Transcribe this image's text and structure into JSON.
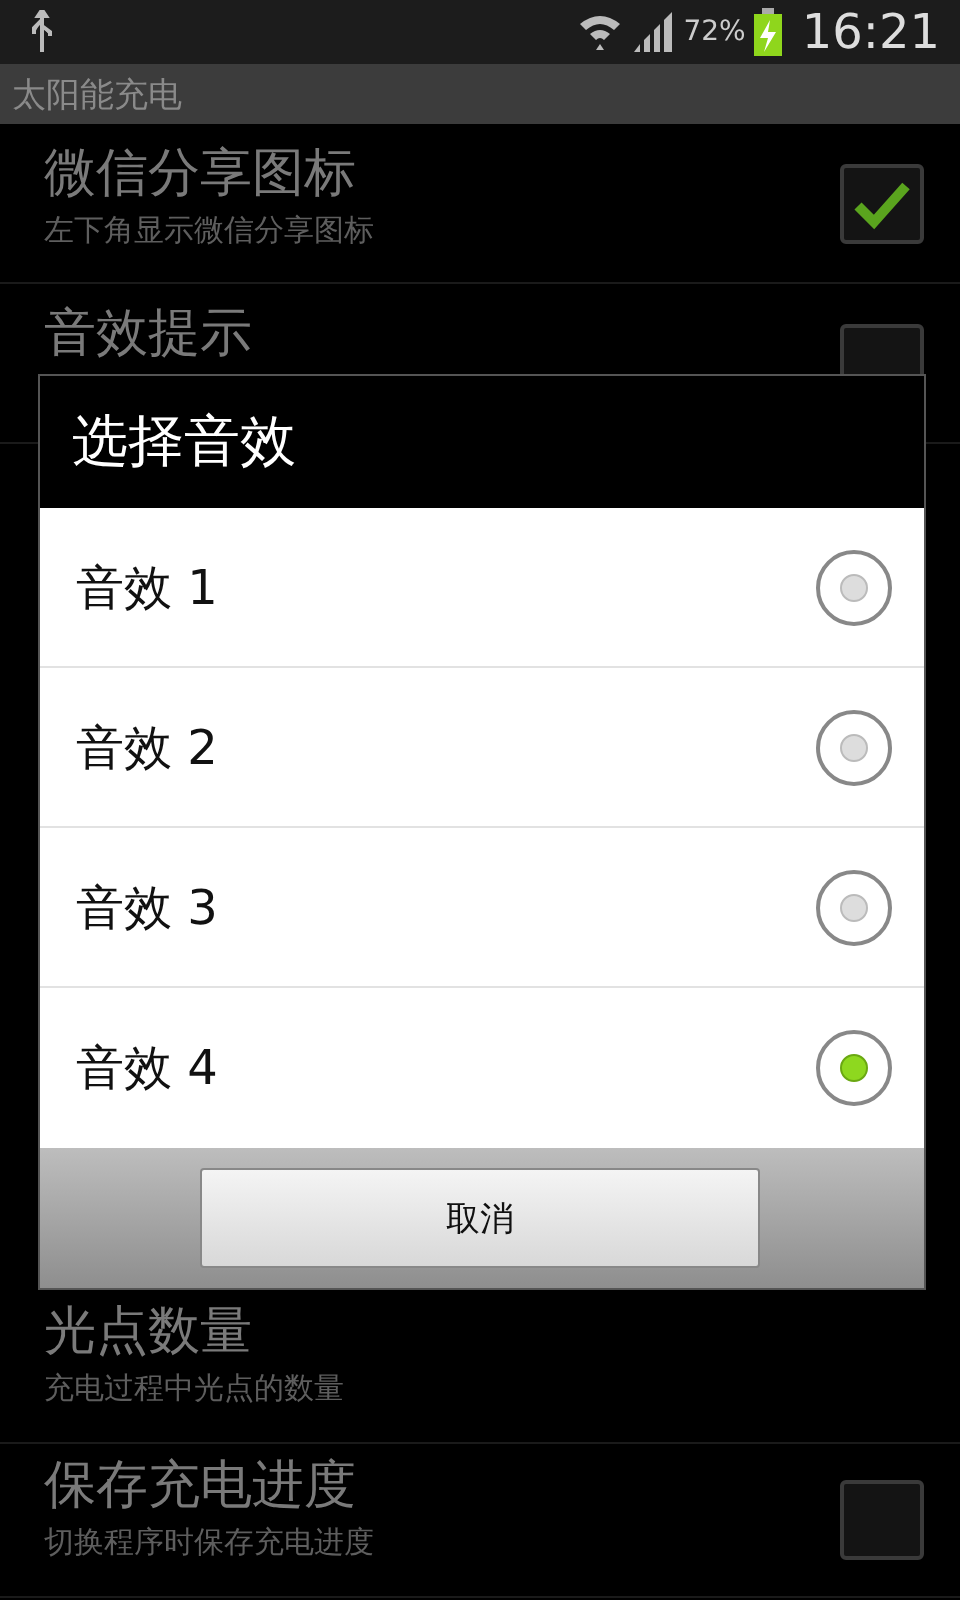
{
  "status_bar": {
    "battery_percent": "72%",
    "time": "16:21"
  },
  "app_bar": {
    "title": "太阳能充电"
  },
  "settings_top": [
    {
      "title": "微信分享图标",
      "summary": "左下角显示微信分享图标",
      "checked": true
    },
    {
      "title": "音效提示",
      "checked": false
    }
  ],
  "settings_bottom": [
    {
      "title": "光点数量",
      "summary": "充电过程中光点的数量",
      "kind": "plain"
    },
    {
      "title": "保存充电进度",
      "summary": "切换程序时保存充电进度",
      "kind": "checkbox",
      "checked": false
    }
  ],
  "dialog": {
    "title": "选择音效",
    "options": [
      {
        "label": "音效 1",
        "selected": false
      },
      {
        "label": "音效 2",
        "selected": false
      },
      {
        "label": "音效 3",
        "selected": false
      },
      {
        "label": "音效 4",
        "selected": true
      }
    ],
    "cancel_button": "取消"
  }
}
